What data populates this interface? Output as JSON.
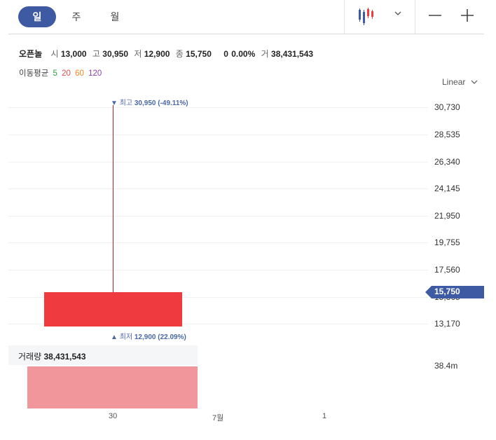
{
  "toolbar": {
    "tabs": [
      {
        "label": "일",
        "active": true
      },
      {
        "label": "주",
        "active": false
      },
      {
        "label": "월",
        "active": false
      }
    ],
    "chart_type_icon": "candlestick-icon",
    "zoom_out_icon": "minus-icon",
    "zoom_in_icon": "plus-icon"
  },
  "ohlc": {
    "name": "오픈놀",
    "open_key": "시",
    "open": "13,000",
    "high_key": "고",
    "high": "30,950",
    "low_key": "저",
    "low": "12,900",
    "close_key": "종",
    "close": "15,750",
    "change": "0",
    "change_pct": "0.00%",
    "volume_key": "거",
    "volume": "38,431,543"
  },
  "moving_average": {
    "label": "이동평균",
    "periods": [
      "5",
      "20",
      "60",
      "120"
    ],
    "colors": [
      "#2ea043",
      "#e24a4a",
      "#f08a24",
      "#8e44ad"
    ]
  },
  "scale": {
    "label": "Linear"
  },
  "colors": {
    "accent": "#3e5aa3",
    "up_candle": "#ef3a3f",
    "volume_bar": "#f1979b",
    "annotation": "#4a68a8"
  },
  "chart_data": {
    "type": "candlestick",
    "candles": [
      {
        "x": "30",
        "open": 13000,
        "high": 30950,
        "low": 12900,
        "close": 15750,
        "volume": 38431543
      }
    ],
    "y_ticks": [
      "30,730",
      "28,535",
      "26,340",
      "24,145",
      "21,950",
      "19,755",
      "17,560",
      "15,365",
      "13,170"
    ],
    "x_ticks": [
      "30",
      "7월",
      "1"
    ],
    "high_annotation": {
      "prefix": "최고",
      "value": "30,950",
      "pct": "(-49.11%)"
    },
    "low_annotation": {
      "prefix": "최저",
      "value": "12,900",
      "pct": "(22.09%)"
    },
    "last_price": "15,750",
    "volume_label": "거래량",
    "volume_value": "38,431,543",
    "volume_tick": "38.4m"
  }
}
